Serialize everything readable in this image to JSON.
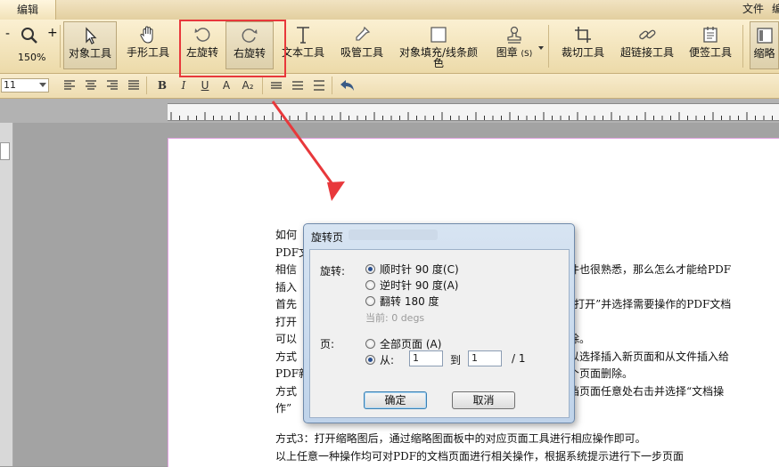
{
  "tabs": {
    "active": "编辑"
  },
  "top_menu": {
    "file": "文件",
    "overflow": "编"
  },
  "ribbon": {
    "zoom_level": "150%",
    "zoom_minus": "-",
    "zoom_plus": "+",
    "tools": [
      {
        "label": "对象工具",
        "icon": "cursor-arrow-icon"
      },
      {
        "label": "手形工具",
        "icon": "hand-icon"
      },
      {
        "label": "左旋转",
        "icon": "rotate-left-icon"
      },
      {
        "label": "右旋转",
        "icon": "rotate-right-icon"
      },
      {
        "label": "文本工具",
        "icon": "text-t-icon"
      },
      {
        "label": "吸管工具",
        "icon": "eyedropper-icon"
      },
      {
        "label_line1": "对象填充/线条颜",
        "label_line2": "色",
        "icon": "fill-square-icon"
      },
      {
        "label": "图章",
        "suffix": "(S)",
        "icon": "stamp-icon"
      },
      {
        "label": "裁切工具",
        "icon": "crop-icon"
      },
      {
        "label": "超链接工具",
        "icon": "link-icon"
      },
      {
        "label": "便签工具",
        "icon": "note-icon"
      },
      {
        "label": "缩略",
        "icon": "thumbnail-icon"
      }
    ]
  },
  "format_bar": {
    "font_size": "11",
    "buttons": [
      "B",
      "I",
      "U",
      "A",
      "A₂"
    ]
  },
  "document": {
    "lines": [
      "如何",
      "PDF文",
      "相信",
      "插入",
      "首先",
      "打开",
      "可以",
      "方式",
      "PDF新",
      "方式",
      "作”"
    ],
    "right_lines": [
      "件也很熟悉，那么怎么才能给PDF",
      "“打开”并选择需要操作的PDF文档",
      "除。",
      "以选择插入新页面和从文件插入给",
      "个页面删除。",
      "档页面任意处右击并选择“文档操"
    ],
    "bottom_lines": [
      "方式3：打开缩略图后，通过缩略图面板中的对应页面工具进行相应操作即可。",
      "以上任意一种操作均可对PDF的文档页面进行相关操作，根据系统提示进行下一步页面"
    ]
  },
  "dialog": {
    "title": "旋转页",
    "rotation_label": "旋转:",
    "options": [
      {
        "label": "顺时针 90 度(C)",
        "selected": true
      },
      {
        "label": "逆时针 90 度(A)",
        "selected": false
      },
      {
        "label": "翻转 180 度",
        "selected": false
      }
    ],
    "current": "当前:  0 degs",
    "pages_label": "页:",
    "all_pages": "全部页面 (A)",
    "from_label": "从:",
    "from_value": "1",
    "to_label": "到",
    "to_value": "1",
    "total": "/  1",
    "ok": "确定",
    "cancel": "取消"
  },
  "colors": {
    "annotation_red": "#e8383b",
    "ribbon_bg": "#f3e4bd",
    "dialog_bg": "#cddcee"
  }
}
